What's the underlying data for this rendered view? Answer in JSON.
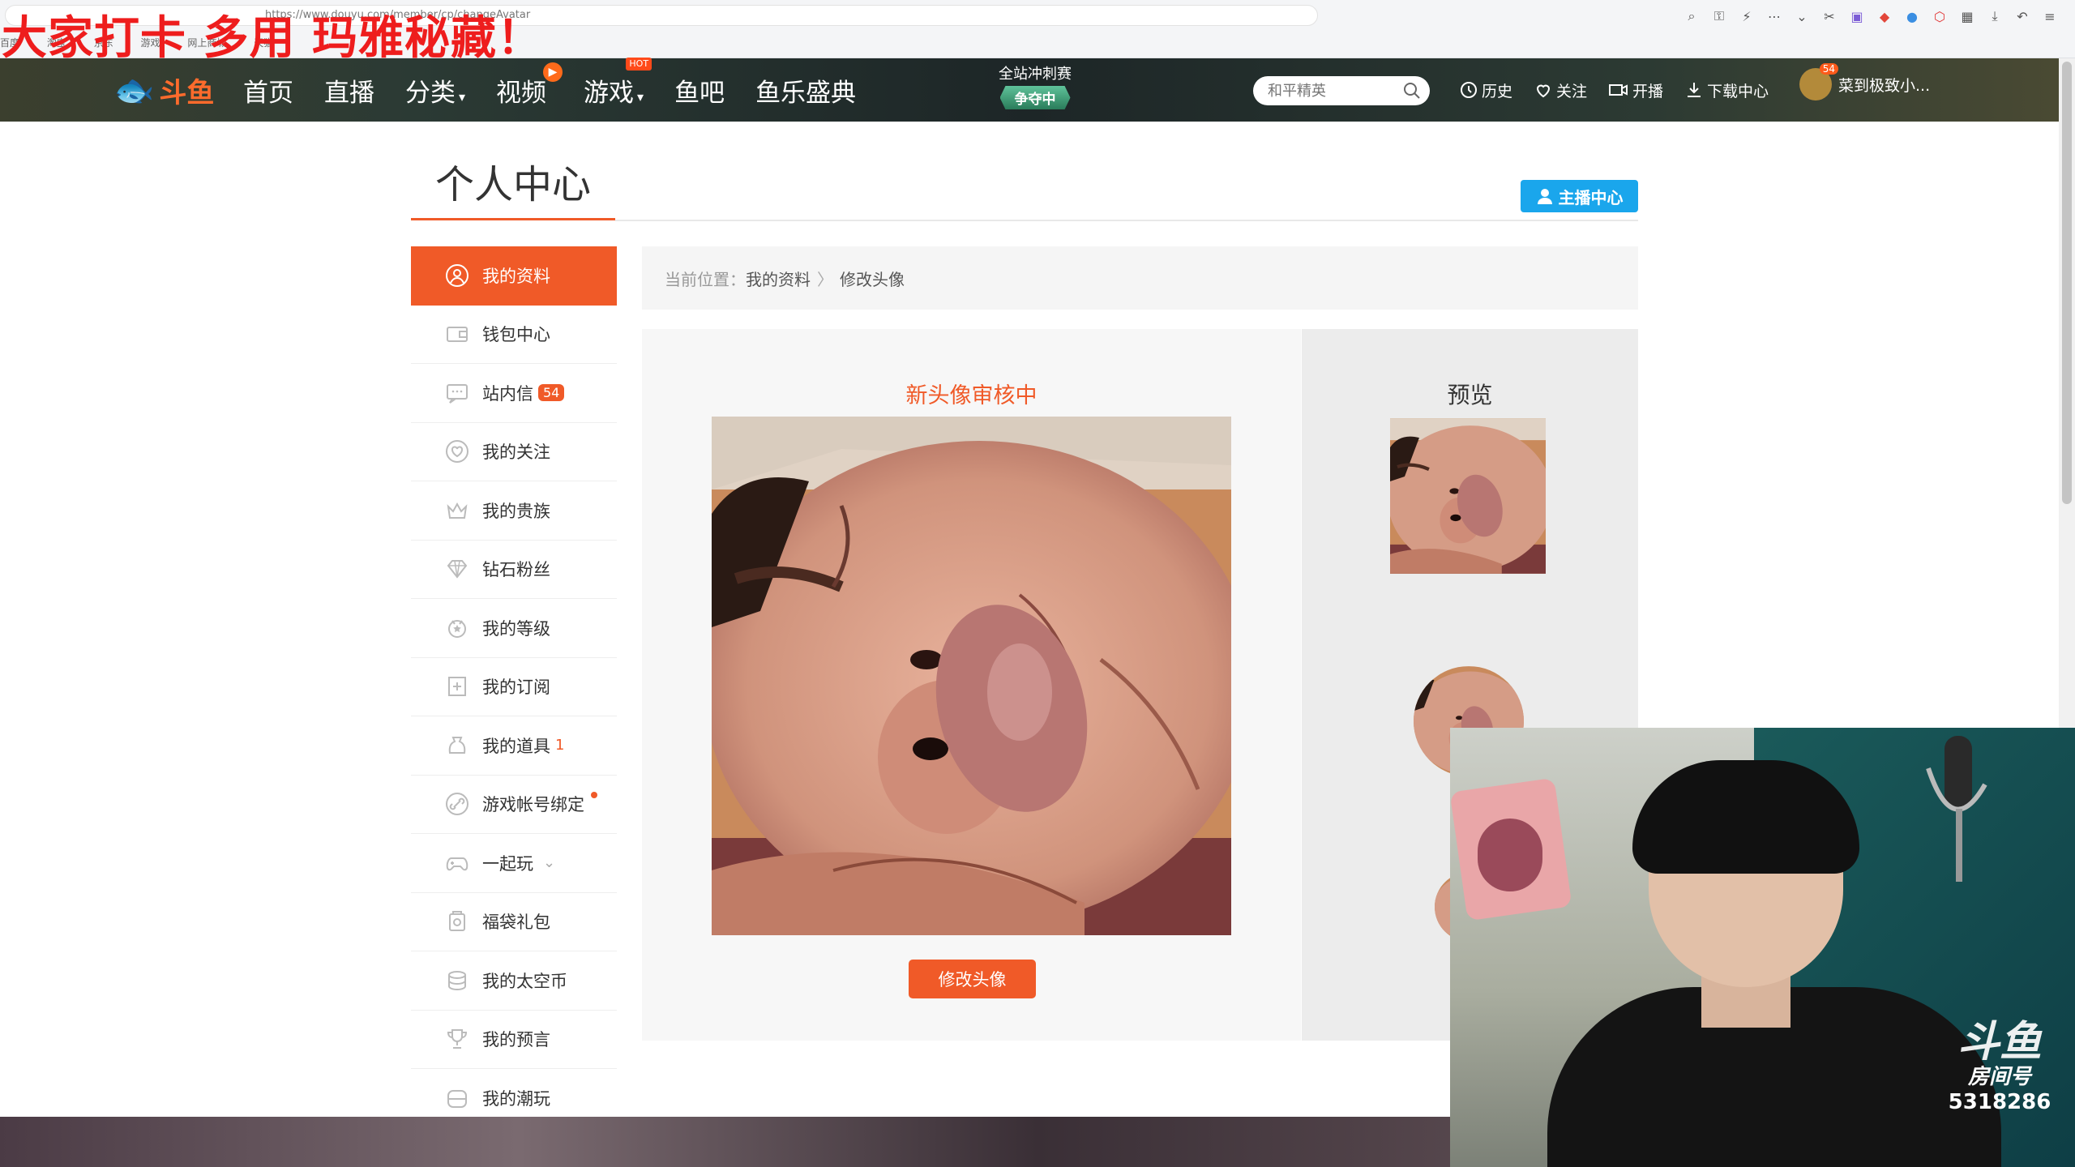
{
  "overlay": {
    "text": "大家打卡 多用 玛雅秘藏！"
  },
  "browser": {
    "url": "https://www.douyu.com/member/cp/changeAvatar",
    "bookmarks": [
      "百度",
      "淘宝",
      "京东",
      "游戏",
      "网上商城",
      "天猫"
    ]
  },
  "nav": {
    "logo_text": "斗鱼",
    "items": [
      {
        "label": "首页"
      },
      {
        "label": "直播"
      },
      {
        "label": "分类"
      },
      {
        "label": "视频"
      },
      {
        "label": "游戏",
        "badge": "HOT"
      },
      {
        "label": "鱼吧"
      },
      {
        "label": "鱼乐盛典"
      }
    ],
    "event": {
      "line1": "全站冲刺赛",
      "line2": "争夺中"
    },
    "search_placeholder": "和平精英",
    "right_items": [
      {
        "label": "历史",
        "icon": "clock-icon"
      },
      {
        "label": "关注",
        "icon": "heart-icon"
      },
      {
        "label": "开播",
        "icon": "camera-icon"
      },
      {
        "label": "下载中心",
        "icon": "download-icon"
      }
    ],
    "user": {
      "name": "菜到极致小...",
      "badge": "54"
    }
  },
  "page": {
    "title": "个人中心",
    "streamer_button": "主播中心",
    "breadcrumb": {
      "prefix": "当前位置：",
      "level1": "我的资料",
      "sep": "〉",
      "level2": "修改头像"
    },
    "edit": {
      "status": "新头像审核中",
      "button": "修改头像"
    },
    "preview": {
      "title": "预览"
    }
  },
  "sidebar": [
    {
      "label": "我的资料",
      "icon": "user-icon",
      "active": true
    },
    {
      "label": "钱包中心",
      "icon": "wallet-icon"
    },
    {
      "label": "站内信",
      "icon": "message-icon",
      "badge": "54"
    },
    {
      "label": "我的关注",
      "icon": "heart-icon"
    },
    {
      "label": "我的贵族",
      "icon": "crown-icon"
    },
    {
      "label": "钻石粉丝",
      "icon": "diamond-icon"
    },
    {
      "label": "我的等级",
      "icon": "level-icon"
    },
    {
      "label": "我的订阅",
      "icon": "subscribe-icon"
    },
    {
      "label": "我的道具",
      "icon": "bag-icon",
      "count": "1"
    },
    {
      "label": "游戏帐号绑定",
      "icon": "link-icon",
      "dot": true
    },
    {
      "label": "一起玩",
      "icon": "gamepad-icon",
      "expandable": true
    },
    {
      "label": "福袋礼包",
      "icon": "gift-icon"
    },
    {
      "label": "我的太空币",
      "icon": "coin-icon"
    },
    {
      "label": "我的预言",
      "icon": "trophy-icon"
    },
    {
      "label": "我的潮玩",
      "icon": "toy-icon"
    }
  ],
  "webcam": {
    "logo": "斗鱼",
    "room_label": "房间号",
    "room_number": "5318286"
  }
}
